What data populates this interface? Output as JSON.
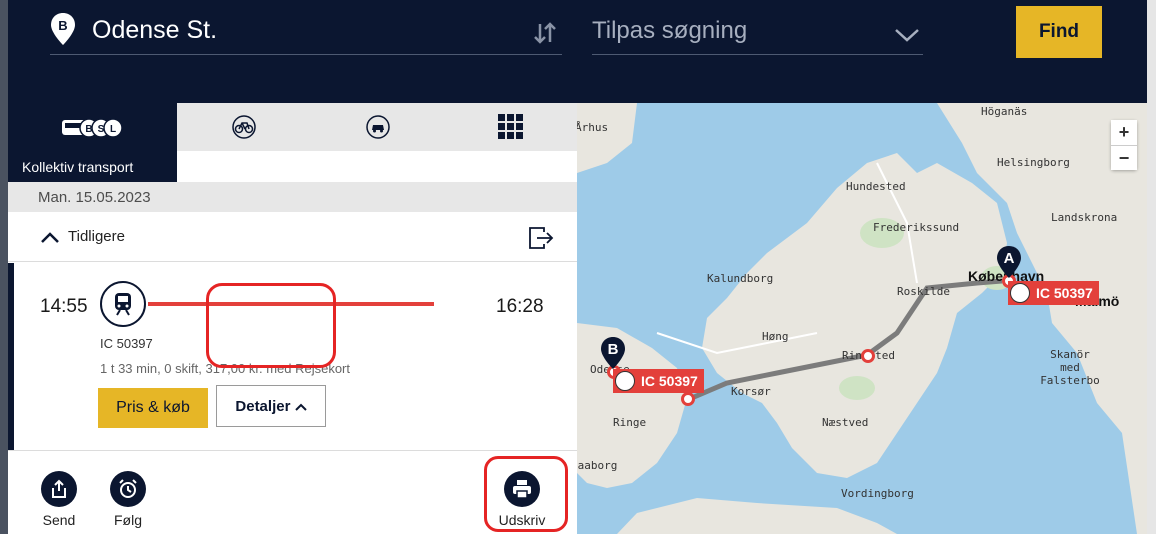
{
  "search": {
    "from_label": "Odense St.",
    "to_placeholder": "Tilpas søgning",
    "find_label": "Find",
    "from_marker": "B"
  },
  "modes": {
    "active_label": "Kollektiv transport",
    "tabs": [
      "public-transport-icon",
      "bike-icon",
      "car-icon",
      "grid-icon"
    ]
  },
  "results": {
    "date": "Man. 15.05.2023",
    "earlier_label": "Tidligere",
    "trip": {
      "departure": "14:55",
      "arrival": "16:28",
      "line": "IC 50397",
      "meta": "1 t 33 min, 0 skift, 317,00 kr. med Rejsekort",
      "buy_label": "Pris & køb",
      "details_label": "Detaljer"
    }
  },
  "actions": {
    "send_label": "Send",
    "follow_label": "Følg",
    "print_label": "Udskriv"
  },
  "map": {
    "zoom_in": "+",
    "zoom_out": "−",
    "marker_a": "A",
    "marker_b": "B",
    "train_tag_1": "IC 50397",
    "train_tag_2": "IC 50397",
    "places": {
      "hoganas": "Höganäs",
      "helsingborg": "Helsingborg",
      "hundested": "Hundested",
      "landskrona": "Landskrona",
      "frederikssund": "Frederikssund",
      "kalundborg": "Kalundborg",
      "kobenhavn": "København",
      "malmo": "Malmö",
      "roskilde": "Roskilde",
      "hong": "Høng",
      "ringsted": "Ringsted",
      "skanor": "Skanör med Falsterbo",
      "korsor": "Korsør",
      "ringe": "Ringe",
      "naestved": "Næstved",
      "faaborg": "Faaborg",
      "vordingborg": "Vordingborg",
      "aarhus": "Århus",
      "odense": "Odense"
    }
  },
  "colors": {
    "navy": "#0b1630",
    "accent_yellow": "#e6b626",
    "route_red": "#e3403b"
  }
}
